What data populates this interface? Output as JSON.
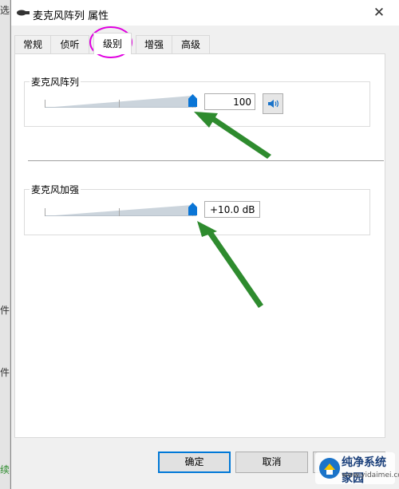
{
  "background": {
    "left_texts": [
      "选",
      "件",
      "件",
      "续"
    ]
  },
  "window": {
    "title": "麦克风阵列 属性",
    "close_icon": "close-icon",
    "tabs": [
      {
        "label": "常规",
        "active": false
      },
      {
        "label": "侦听",
        "active": false
      },
      {
        "label": "级别",
        "active": true
      },
      {
        "label": "增强",
        "active": false
      },
      {
        "label": "高级",
        "active": false
      }
    ]
  },
  "levels": {
    "array": {
      "label": "麦克风阵列",
      "value": "100",
      "level_percent": 100,
      "speaker_icon": "speaker-icon"
    },
    "boost": {
      "label": "麦克风加强",
      "value": "+10.0 dB",
      "level_percent": 100
    }
  },
  "buttons": {
    "ok": "确定",
    "cancel": "取消"
  },
  "annotations": {
    "tab_highlight_color": "#e000e0",
    "arrow_color": "#2e8b2e"
  },
  "watermark": {
    "title": "纯净系统家园",
    "url": "www.yidaimei.com"
  },
  "colors": {
    "accent": "#0a75d6",
    "titlebar": "#ffffff",
    "dialog": "#f0f0f0"
  }
}
